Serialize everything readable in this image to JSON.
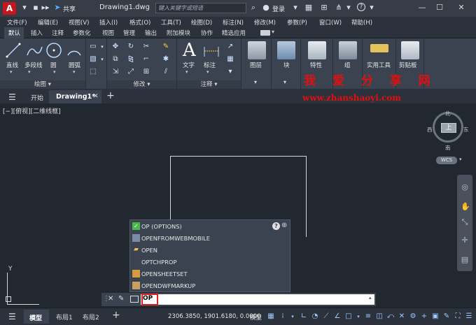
{
  "titlebar": {
    "app_logo": "A",
    "share_label": "共享",
    "doc_title": "Drawing1.dwg",
    "search_placeholder": "键入关键字或短语",
    "login_label": "登录",
    "help_label": "?"
  },
  "menubar": {
    "items": [
      "文件(F)",
      "编辑(E)",
      "视图(V)",
      "插入(I)",
      "格式(O)",
      "工具(T)",
      "绘图(D)",
      "标注(N)",
      "修改(M)",
      "参数(P)",
      "窗口(W)",
      "帮助(H)"
    ]
  },
  "ribbon_tabs": {
    "items": [
      "默认",
      "插入",
      "注释",
      "参数化",
      "视图",
      "管理",
      "输出",
      "附加模块",
      "协作",
      "精选应用"
    ]
  },
  "ribbon": {
    "draw": {
      "title": "绘图",
      "line": "直线",
      "polyline": "多段线",
      "circle": "圆",
      "arc": "圆弧"
    },
    "modify": {
      "title": "修改"
    },
    "annotation": {
      "title": "注释",
      "text": "文字",
      "dimension": "标注"
    },
    "layers": {
      "label": "图层"
    },
    "block": {
      "label": "块"
    },
    "properties": {
      "label": "特性"
    },
    "group": {
      "label": "组"
    },
    "utilities": {
      "label": "实用工具"
    },
    "clipboard": {
      "label": "剪贴板"
    }
  },
  "watermark": {
    "text": "我 爱 分 享 网",
    "url": "www.zhanshaoyi.com"
  },
  "doc_tabs": {
    "start": "开始",
    "drawing": "Drawing1*",
    "add": "+"
  },
  "canvas": {
    "viewport_label": "[−][俯视][二维线框]",
    "ucs_y": "Y"
  },
  "viewcube": {
    "north": "北",
    "south": "南",
    "east": "东",
    "west": "西",
    "face": "上",
    "wcs": "WCS"
  },
  "autocomplete": {
    "items": [
      {
        "label": "OP (OPTIONS)"
      },
      {
        "label": "OPENFROMWEBMOBILE"
      },
      {
        "label": "OPEN"
      },
      {
        "label": "OPTCHPROP"
      },
      {
        "label": "OPENSHEETSET"
      },
      {
        "label": "OPENDWFMARKUP"
      }
    ]
  },
  "command_line": {
    "value": "OP"
  },
  "statusbar": {
    "model_tab": "模型",
    "layout1": "布局1",
    "layout2": "布局2",
    "add": "+",
    "coords": "2306.3850, 1901.6180, 0.0000",
    "model_button": "模型"
  },
  "colors": {
    "accent": "#c4161c",
    "watermark": "#e01010",
    "canvas": "#212830"
  }
}
